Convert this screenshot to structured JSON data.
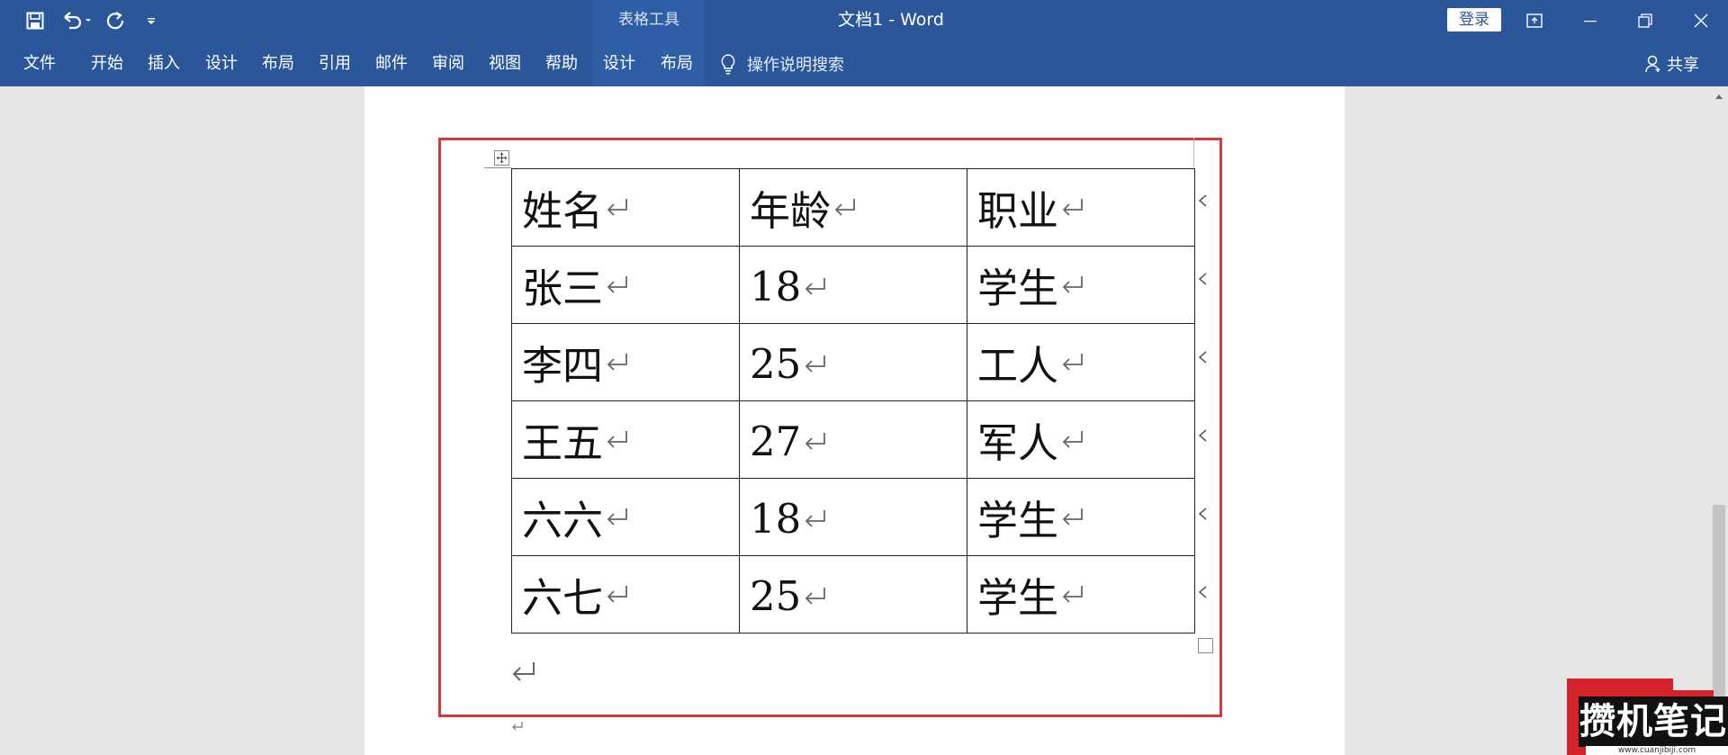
{
  "titlebar": {
    "context_tools_label": "表格工具",
    "doc_title": "文档1  -  Word",
    "login_label": "登录"
  },
  "ribbon": {
    "tabs": [
      "文件",
      "开始",
      "插入",
      "设计",
      "布局",
      "引用",
      "邮件",
      "审阅",
      "视图",
      "帮助"
    ],
    "context_tabs": [
      "设计",
      "布局"
    ],
    "tell_me_text": "操作说明搜索",
    "share_label": "共享"
  },
  "table": {
    "rows": [
      [
        "姓名",
        "年龄",
        "职业"
      ],
      [
        "张三",
        "18",
        "学生"
      ],
      [
        "李四",
        "25",
        "工人"
      ],
      [
        "王五",
        "27",
        "军人"
      ],
      [
        "六六",
        "18",
        "学生"
      ],
      [
        "六七",
        "25",
        "学生"
      ]
    ]
  },
  "watermark": {
    "brand": "攒机笔记",
    "url": "www.cuanjibiji.com"
  },
  "colors": {
    "brand_blue": "#2b579a",
    "highlight_red": "#d43b3b"
  }
}
